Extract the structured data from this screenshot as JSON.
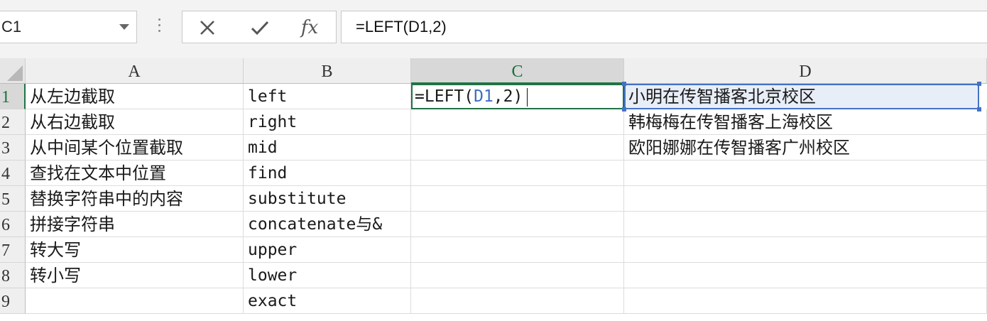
{
  "namebox": {
    "value": "C1"
  },
  "formula_bar": {
    "cancel_icon": "close-icon",
    "enter_icon": "check-icon",
    "fx_label": "fx",
    "formula": "=LEFT(D1,2)"
  },
  "columns": [
    "A",
    "B",
    "C",
    "D"
  ],
  "rows": [
    "1",
    "2",
    "3",
    "4",
    "5",
    "6",
    "7",
    "8",
    "9"
  ],
  "col_a": [
    "从左边截取",
    "从右边截取",
    "从中间某个位置截取",
    "查找在文本中位置",
    "替换字符串中的内容",
    "拼接字符串",
    "转大写",
    "转小写",
    ""
  ],
  "col_b": [
    "left",
    "right",
    "mid",
    "find",
    "substitute",
    "concatenate与&",
    "upper",
    "lower",
    "exact"
  ],
  "col_d": [
    "小明在传智播客北京校区",
    "韩梅梅在传智播客上海校区",
    "欧阳娜娜在传智播客广州校区",
    "",
    "",
    "",
    "",
    "",
    ""
  ],
  "active_cell": {
    "edit_prefix": "=LEFT(",
    "edit_ref": "D1",
    "edit_suffix": ",2)"
  },
  "colors": {
    "accent": "#217346",
    "ref": "#4472c4"
  }
}
